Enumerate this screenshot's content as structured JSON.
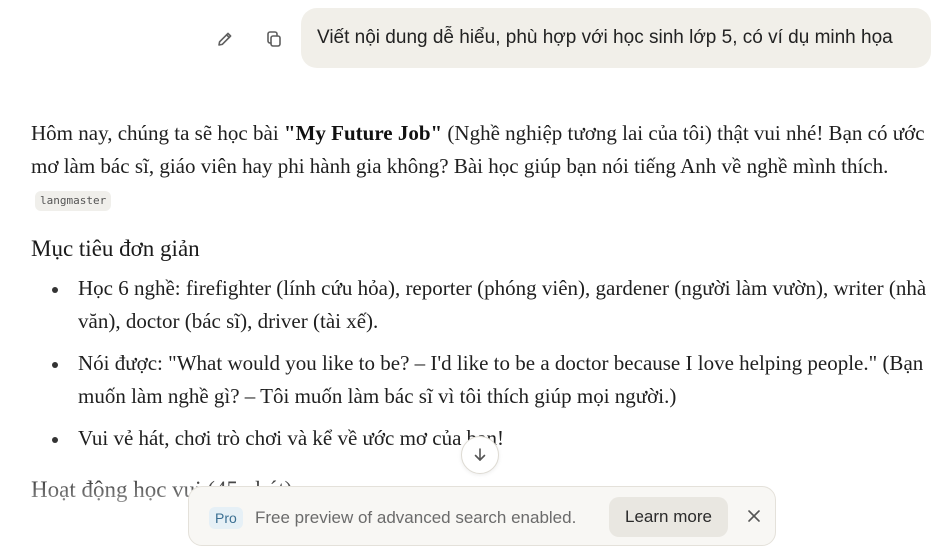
{
  "user_message": {
    "text": "Viết nội dung dễ hiểu, phù hợp với học sinh lớp 5, có ví dụ minh họa",
    "actions": [
      {
        "icon": "pencil-icon",
        "name": "edit-message-button"
      },
      {
        "icon": "copy-icon",
        "name": "copy-message-button"
      }
    ]
  },
  "answer": {
    "intro_before": "Hôm nay, chúng ta sẽ học bài ",
    "intro_bold": "\"My Future Job\"",
    "intro_after": " (Nghề nghiệp tương lai của tôi) thật vui nhé! Bạn có ước mơ làm bác sĩ, giáo viên hay phi hành gia không? Bài học giúp bạn nói tiếng Anh về nghề mình thích.",
    "citation": "langmaster",
    "section1_heading": "Mục tiêu đơn giản",
    "bullets": [
      "Học 6 nghề: firefighter (lính cứu hỏa), reporter (phóng viên), gardener (người làm vườn), writer (nhà văn), doctor (bác sĩ), driver (tài xế).",
      "Nói được: \"What would you like to be? – I'd like to be a doctor because I love helping people.\" (Bạn muốn làm nghề gì? – Tôi muốn làm bác sĩ vì tôi thích giúp mọi người.)",
      "Vui vẻ hát, chơi trò chơi và kể về ước mơ của bạn!"
    ],
    "section2_heading": "Hoạt động học vui (45 phút)"
  },
  "scroll_button": {
    "icon": "arrow-down-icon"
  },
  "banner": {
    "badge": "Pro",
    "text": "Free preview of advanced search enabled.",
    "button": "Learn more",
    "close_icon": "close-icon"
  }
}
